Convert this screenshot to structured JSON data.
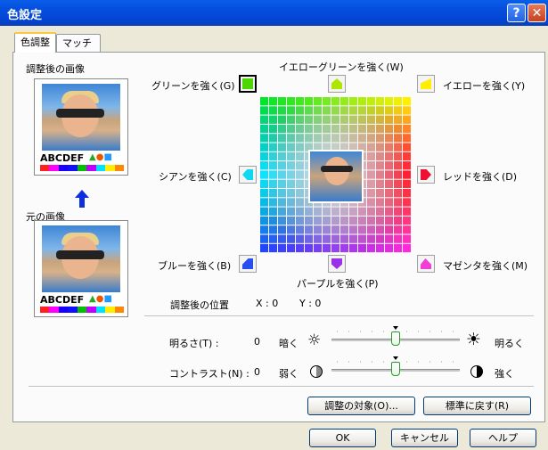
{
  "window": {
    "title": "色設定",
    "help_glyph": "?",
    "close_glyph": "✕"
  },
  "tabs": [
    {
      "label": "色調整"
    },
    {
      "label": "マッチング"
    }
  ],
  "left": {
    "adjusted_label": "調整後の画像",
    "original_label": "元の画像",
    "sample_text": "ABCDEF",
    "arrow_icon": "up-arrow-icon",
    "strip_colors": [
      "#ff2020",
      "#ff00ff",
      "#1a00ff",
      "#1010ff",
      "#00c000",
      "#c000ff",
      "#00e0ff",
      "#ffee00",
      "#ff8800"
    ]
  },
  "color_adjust": {
    "yellow_green": "イエローグリーンを強く(W)",
    "green": "グリーンを強く(G)",
    "yellow": "イエローを強く(Y)",
    "cyan": "シアンを強く(C)",
    "red": "レッドを強く(D)",
    "blue": "ブルーを強く(B)",
    "purple": "パープルを強く(P)",
    "magenta": "マゼンタを強く(M)",
    "colors": {
      "green": "#4dd600",
      "yellow_green": "#aee600",
      "yellow": "#ffee00",
      "cyan": "#12d7f0",
      "red": "#ee1030",
      "blue": "#2850f0",
      "purple": "#9a30e8",
      "magenta": "#f03fd8"
    }
  },
  "position": {
    "label": "調整後の位置",
    "x_text": "X :  0",
    "y_text": "Y :  0"
  },
  "brightness": {
    "label": "明るさ(T) :",
    "value": "0",
    "low": "暗く",
    "high": "明るく",
    "level": 0
  },
  "contrast": {
    "label": "コントラスト(N) :",
    "value": "0",
    "low": "弱く",
    "high": "強く",
    "level": 0
  },
  "buttons": {
    "target": "調整の対象(O)...",
    "reset": "標準に戻す(R)",
    "ok": "OK",
    "cancel": "キャンセル",
    "help": "ヘルプ"
  }
}
